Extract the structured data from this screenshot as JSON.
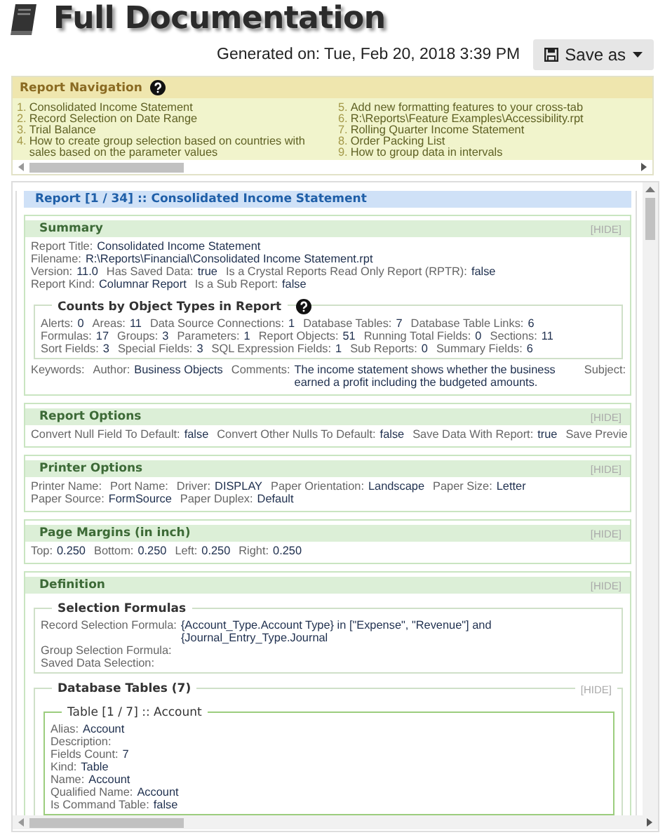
{
  "header": {
    "title": "Full Documentation",
    "generated": "Generated on: Tue, Feb 20, 2018 3:39 PM",
    "save_button": "Save as"
  },
  "navigation": {
    "title": "Report Navigation",
    "help": true,
    "columns": [
      [
        {
          "number": "1.",
          "label": "Consolidated Income Statement"
        },
        {
          "number": "2.",
          "label": "Record Selection on Date Range"
        },
        {
          "number": "3.",
          "label": "Trial Balance"
        },
        {
          "number": "4.",
          "label": "How to create group selection based on countries with sales based on the parameter values"
        }
      ],
      [
        {
          "number": "5.",
          "label": "Add new formatting features to your cross-tab"
        },
        {
          "number": "6.",
          "label": "R:\\Reports\\Feature Examples\\Accessibility.rpt"
        },
        {
          "number": "7.",
          "label": "Rolling Quarter Income Statement"
        },
        {
          "number": "8.",
          "label": "Order Packing List"
        },
        {
          "number": "9.",
          "label": "How to group data in intervals"
        }
      ]
    ]
  },
  "report": {
    "title": "Report [1 / 34] :: Consolidated Income Statement",
    "sections": [
      {
        "title": "Summary",
        "hide": "[HIDE]",
        "blocks": [
          {
            "kind": "lines",
            "lines": [
              [
                {
                  "label": "Report Title:",
                  "value": "Consolidated Income Statement"
                }
              ],
              [
                {
                  "label": "Filename:",
                  "value": "R:\\Reports\\Financial\\Consolidated Income Statement.rpt"
                }
              ],
              [
                {
                  "label": "Version:",
                  "value": "11.0"
                },
                {
                  "label": "Has Saved Data:",
                  "value": "true"
                },
                {
                  "label": "Is a Crystal Reports Read Only Report (RPTR):",
                  "value": "false"
                }
              ],
              [
                {
                  "label": "Report Kind:",
                  "value": "Columnar Report"
                },
                {
                  "label": "Is a Sub Report:",
                  "value": "false"
                }
              ]
            ]
          },
          {
            "kind": "group",
            "title": "Counts by Object Types in Report",
            "help": true,
            "blocks": [
              {
                "kind": "lines",
                "lines": [
                  [
                    {
                      "label": "Alerts:",
                      "value": "0"
                    },
                    {
                      "label": "Areas:",
                      "value": "11"
                    },
                    {
                      "label": "Data Source Connections:",
                      "value": "1"
                    },
                    {
                      "label": "Database Tables:",
                      "value": "7"
                    },
                    {
                      "label": "Database Table Links:",
                      "value": "6"
                    }
                  ],
                  [
                    {
                      "label": "Formulas:",
                      "value": "17"
                    },
                    {
                      "label": "Groups:",
                      "value": "3"
                    },
                    {
                      "label": "Parameters:",
                      "value": "1"
                    },
                    {
                      "label": "Report Objects:",
                      "value": "51"
                    },
                    {
                      "label": "Running Total Fields:",
                      "value": "0"
                    },
                    {
                      "label": "Sections:",
                      "value": "11"
                    }
                  ],
                  [
                    {
                      "label": "Sort Fields:",
                      "value": "3"
                    },
                    {
                      "label": "Special Fields:",
                      "value": "3"
                    },
                    {
                      "label": "SQL Expression Fields:",
                      "value": "1"
                    },
                    {
                      "label": "Sub Reports:",
                      "value": "0"
                    },
                    {
                      "label": "Summary Fields:",
                      "value": "6"
                    }
                  ]
                ]
              }
            ]
          },
          {
            "kind": "lines",
            "lines": [
              [
                {
                  "label": "Keywords:"
                },
                {
                  "label": "Author:",
                  "value": "Business Objects"
                },
                {
                  "label": "Comments:",
                  "value": "The income statement shows whether the business earned a profit including the budgeted amounts."
                },
                {
                  "label": "Subject:"
                }
              ]
            ]
          }
        ]
      },
      {
        "title": "Report Options",
        "hide": "[HIDE]",
        "blocks": [
          {
            "kind": "lines",
            "lines": [
              [
                {
                  "label": "Convert Null Field To Default:",
                  "value": "false"
                },
                {
                  "label": "Convert Other Nulls To Default:",
                  "value": "false"
                },
                {
                  "label": "Save Data With Report:",
                  "value": "true"
                },
                {
                  "label": "Save Previe"
                }
              ]
            ]
          }
        ]
      },
      {
        "title": "Printer Options",
        "hide": "[HIDE]",
        "blocks": [
          {
            "kind": "lines",
            "lines": [
              [
                {
                  "label": "Printer Name:"
                },
                {
                  "label": "Port Name:"
                },
                {
                  "label": "Driver:",
                  "value": "DISPLAY"
                },
                {
                  "label": "Paper Orientation:",
                  "value": "Landscape"
                },
                {
                  "label": "Paper Size:",
                  "value": "Letter"
                }
              ],
              [
                {
                  "label": "Paper Source:",
                  "value": "FormSource"
                },
                {
                  "label": "Paper Duplex:",
                  "value": "Default"
                }
              ]
            ]
          }
        ]
      },
      {
        "title": "Page Margins (in inch)",
        "hide": "[HIDE]",
        "blocks": [
          {
            "kind": "lines",
            "lines": [
              [
                {
                  "label": "Top:",
                  "value": "0.250"
                },
                {
                  "label": "Bottom:",
                  "value": "0.250"
                },
                {
                  "label": "Left:",
                  "value": "0.250"
                },
                {
                  "label": "Right:",
                  "value": "0.250"
                }
              ]
            ]
          }
        ]
      },
      {
        "title": "Definition",
        "hide": "[HIDE]",
        "blocks": [
          {
            "kind": "group",
            "title": "Selection Formulas",
            "blocks": [
              {
                "kind": "lines",
                "lines": [
                  [
                    {
                      "label": "Record Selection Formula:",
                      "value": "{Account_Type.Account Type} in [\"Expense\", \"Revenue\"] and {Journal_Entry_Type.Journal"
                    }
                  ],
                  [
                    {
                      "label": "Group Selection Formula:"
                    }
                  ],
                  [
                    {
                      "label": "Saved Data Selection:"
                    }
                  ]
                ]
              }
            ]
          },
          {
            "kind": "group",
            "title": "Database Tables (7)",
            "hide": "[HIDE]",
            "blocks": [
              {
                "kind": "table",
                "title": "Table [1 / 7] :: Account",
                "blocks": [
                  {
                    "kind": "lines",
                    "lines": [
                      [
                        {
                          "label": "Alias:",
                          "value": "Account"
                        }
                      ],
                      [
                        {
                          "label": "Description:"
                        }
                      ],
                      [
                        {
                          "label": "Fields Count:",
                          "value": "7"
                        }
                      ],
                      [
                        {
                          "label": "Kind:",
                          "value": "Table"
                        }
                      ],
                      [
                        {
                          "label": "Name:",
                          "value": "Account"
                        }
                      ],
                      [
                        {
                          "label": "Qualified Name:",
                          "value": "Account"
                        }
                      ],
                      [
                        {
                          "label": "Is Command Table:",
                          "value": "false"
                        }
                      ]
                    ]
                  }
                ]
              }
            ]
          }
        ]
      }
    ]
  }
}
